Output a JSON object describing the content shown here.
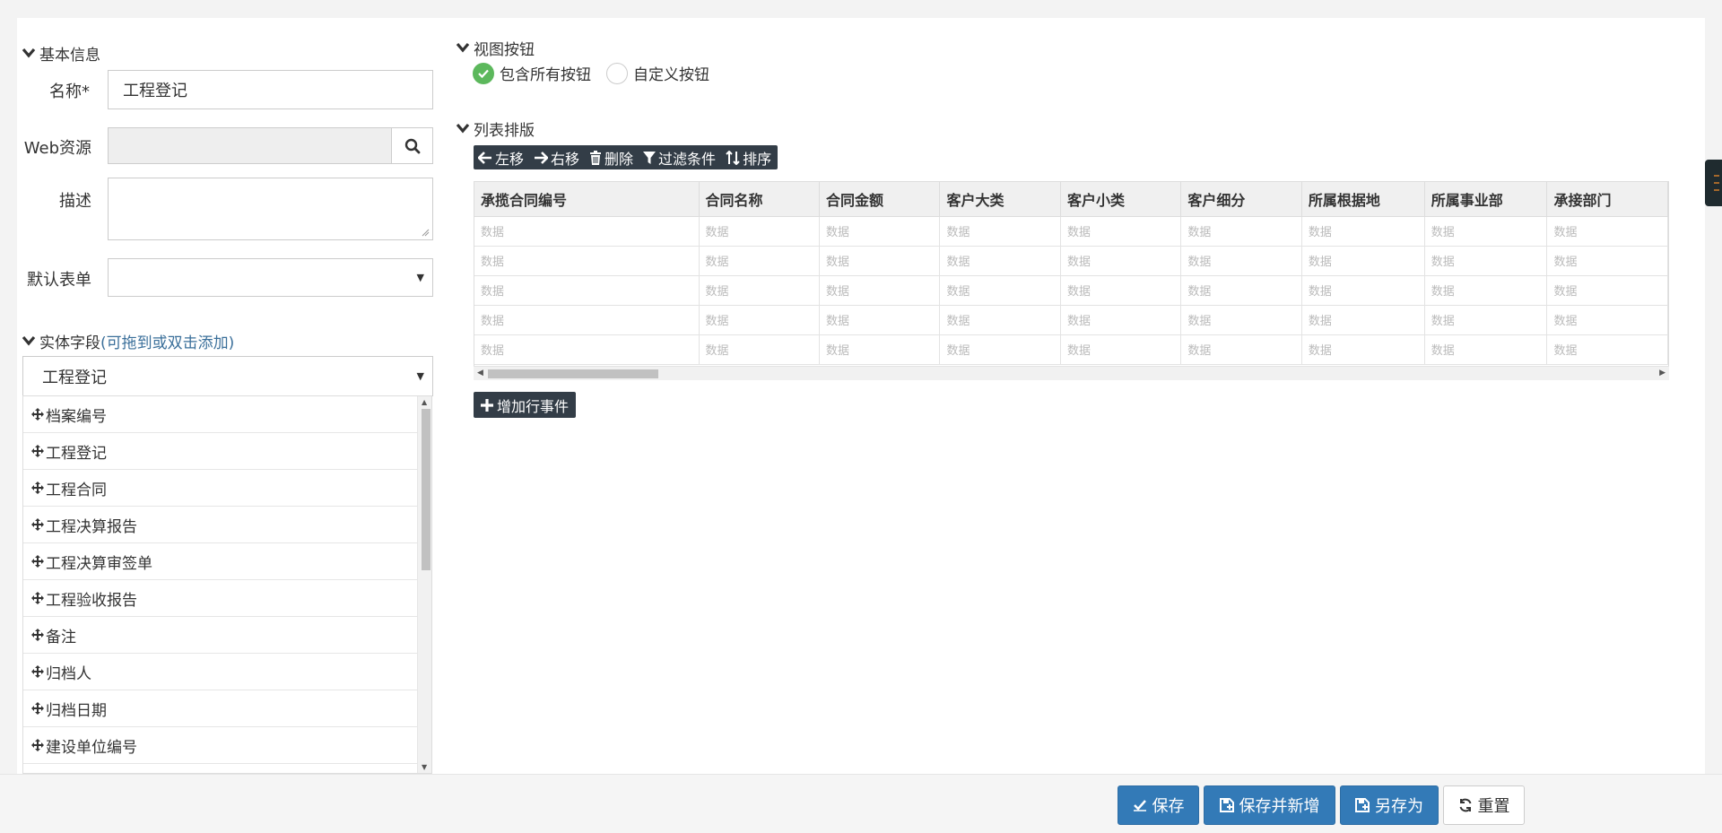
{
  "basic_info": {
    "title": "基本信息",
    "name_label": "名称*",
    "name_value": "工程登记",
    "web_resource_label": "Web资源",
    "web_resource_value": "",
    "description_label": "描述",
    "description_value": "",
    "default_form_label": "默认表单",
    "default_form_value": ""
  },
  "entity_fields": {
    "title": "实体字段",
    "hint": "(可拖到或双击添加)",
    "selected_entity": "工程登记",
    "items": [
      "档案编号",
      "工程登记",
      "工程合同",
      "工程决算报告",
      "工程决算审签单",
      "工程验收报告",
      "备注",
      "归档人",
      "归档日期",
      "建设单位编号"
    ]
  },
  "view_buttons": {
    "title": "视图按钮",
    "option_all": "包含所有按钮",
    "option_custom": "自定义按钮",
    "selected": "option_all"
  },
  "list_layout": {
    "title": "列表排版",
    "toolbar": {
      "left": "左移",
      "right": "右移",
      "delete": "删除",
      "filter": "过滤条件",
      "sort": "排序"
    },
    "columns": [
      "承揽合同编号",
      "合同名称",
      "合同金额",
      "客户大类",
      "客户小类",
      "客户细分",
      "所属根据地",
      "所属事业部",
      "承接部门"
    ],
    "placeholder_cell": "数据",
    "row_count": 5,
    "add_event_label": "增加行事件"
  },
  "footer": {
    "save": "保存",
    "save_and_new": "保存并新增",
    "save_as": "另存为",
    "reset": "重置"
  },
  "colors": {
    "primary": "#337ab7",
    "dark_toolbar": "#333d47",
    "success": "#5cb85c",
    "hint": "#3a6f9a"
  }
}
